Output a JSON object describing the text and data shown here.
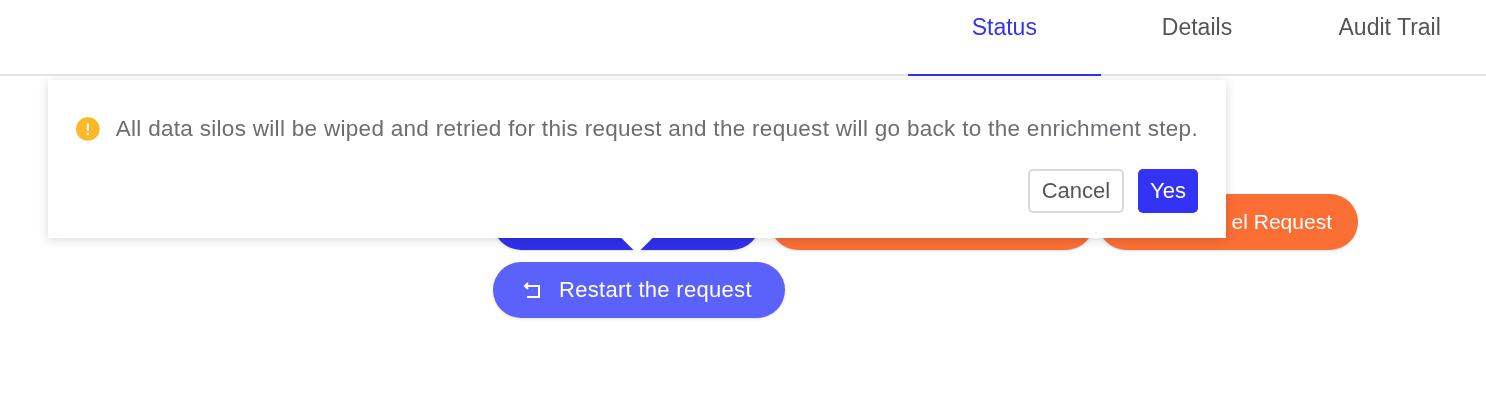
{
  "tabs": [
    {
      "label": "Status",
      "selected": true
    },
    {
      "label": "Details",
      "selected": false
    },
    {
      "label": "Audit Trail",
      "selected": false
    }
  ],
  "actions": [
    {
      "kind": "primary"
    },
    {
      "kind": "danger"
    },
    {
      "kind": "danger",
      "label": "el Request"
    }
  ],
  "restart_button": {
    "label": "Restart the request"
  },
  "confirm_popover": {
    "message": "All data silos will be wiped and retried for this request and the request will go back to the enrichment step.",
    "buttons": [
      {
        "label": "Cancel",
        "kind": "secondary"
      },
      {
        "label": "Yes",
        "kind": "primary"
      }
    ]
  }
}
